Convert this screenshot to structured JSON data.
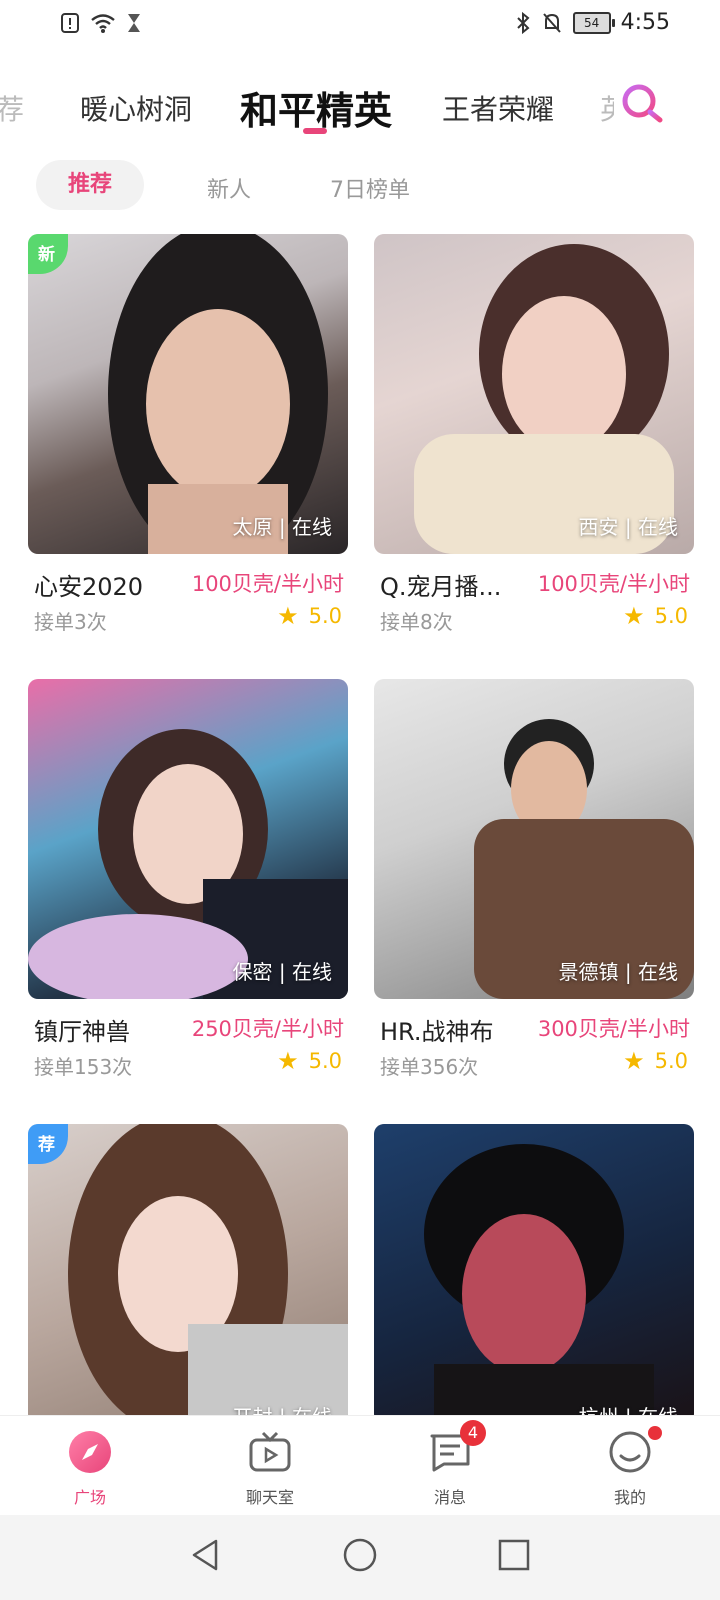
{
  "status_bar": {
    "time": "4:55",
    "battery": "54"
  },
  "top_tabs": [
    {
      "label": "荐"
    },
    {
      "label": "暖心树洞"
    },
    {
      "label": "和平精英",
      "active": true
    },
    {
      "label": "王者荣耀"
    },
    {
      "label": "英"
    }
  ],
  "sub_tabs": [
    {
      "label": "推荐",
      "active": true
    },
    {
      "label": "新人"
    },
    {
      "label": "7日榜单"
    }
  ],
  "cards": [
    {
      "name": "心安2020",
      "price": "100贝壳/半小时",
      "orders": "接单3次",
      "rating": "5.0",
      "location": "太原 | 在线",
      "tag": "新"
    },
    {
      "name": "Q.宠月播...",
      "price": "100贝壳/半小时",
      "orders": "接单8次",
      "rating": "5.0",
      "location": "西安 | 在线"
    },
    {
      "name": "镇厅神兽",
      "price": "250贝壳/半小时",
      "orders": "接单153次",
      "rating": "5.0",
      "location": "保密 | 在线"
    },
    {
      "name": "HR.战神布",
      "price": "300贝壳/半小时",
      "orders": "接单356次",
      "rating": "5.0",
      "location": "景德镇 | 在线"
    },
    {
      "location": "开封 | 在线",
      "tag": "荐"
    },
    {
      "location": "杭州 | 在线"
    }
  ],
  "bottom_nav": [
    {
      "label": "广场",
      "icon": "compass-icon",
      "active": true
    },
    {
      "label": "聊天室",
      "icon": "tv-icon"
    },
    {
      "label": "消息",
      "icon": "message-icon",
      "badge": "4"
    },
    {
      "label": "我的",
      "icon": "smile-icon"
    }
  ],
  "colors": {
    "accent": "#e8457a",
    "star": "#f5b800",
    "tag_new": "#59d86e",
    "tag_rec": "#3f9cf6"
  }
}
